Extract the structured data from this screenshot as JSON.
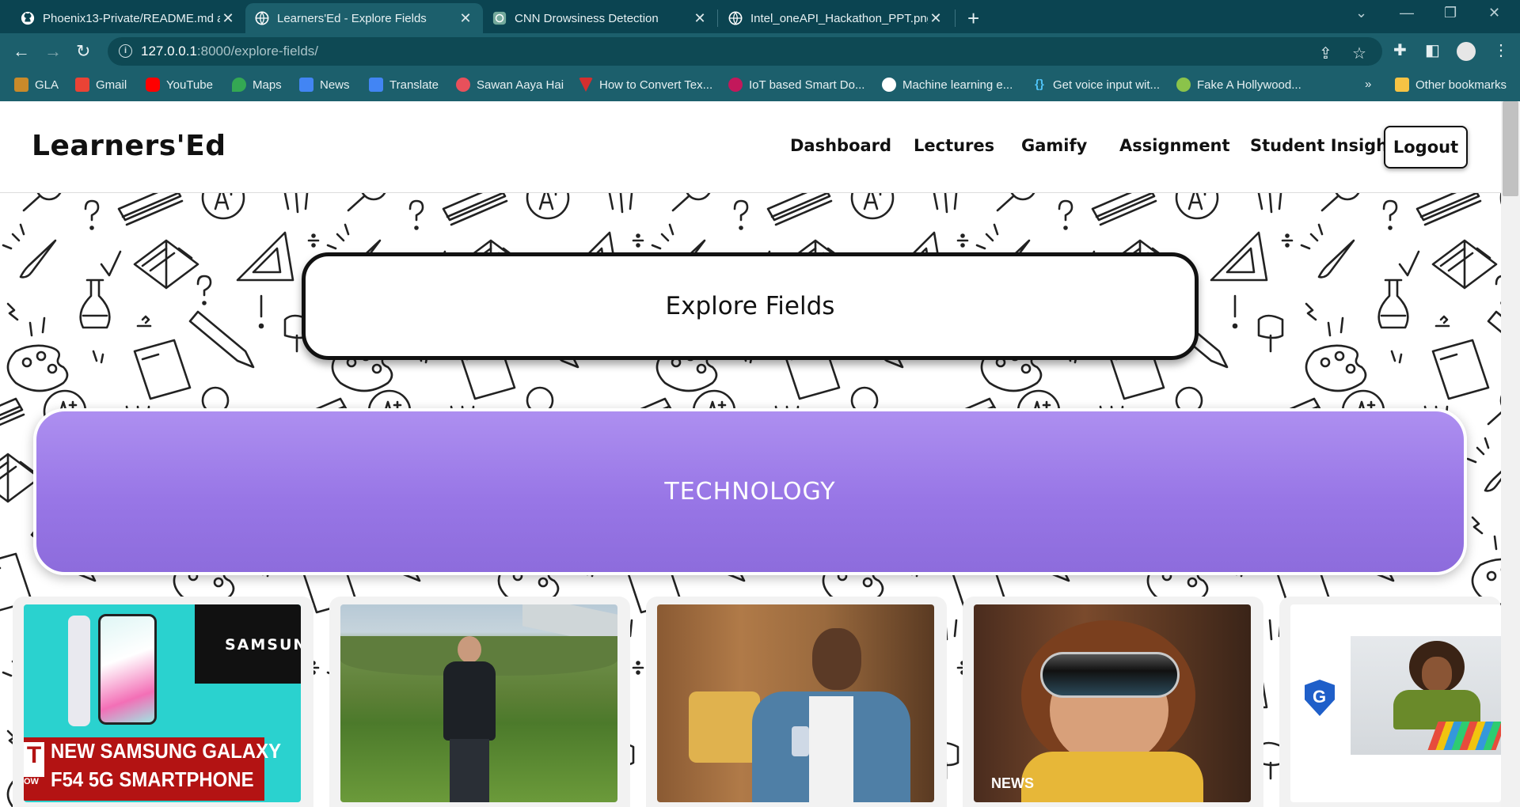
{
  "browser": {
    "tabs": [
      {
        "title": "Phoenix13-Private/README.md a",
        "active": false
      },
      {
        "title": "Learners'Ed - Explore Fields",
        "active": true
      },
      {
        "title": "CNN Drowsiness Detection",
        "active": false
      },
      {
        "title": "Intel_oneAPI_Hackathon_PPT.png",
        "active": false
      }
    ],
    "url_host": "127.0.0.1",
    "url_rest": ":8000/explore-fields/",
    "bookmarks": [
      {
        "label": "GLA",
        "color": "#c98a2a"
      },
      {
        "label": "Gmail",
        "color": "#ea4335"
      },
      {
        "label": "YouTube",
        "color": "#ff0000"
      },
      {
        "label": "Maps",
        "color": "#34a853"
      },
      {
        "label": "News",
        "color": "#4285f4"
      },
      {
        "label": "Translate",
        "color": "#4285f4"
      },
      {
        "label": "Sawan Aaya Hai",
        "color": "#e8505b"
      },
      {
        "label": "How to Convert Tex...",
        "color": "#d32f2f"
      },
      {
        "label": "IoT based Smart Do...",
        "color": "#c2185b"
      },
      {
        "label": "Machine learning e...",
        "color": "#ffffff"
      },
      {
        "label": "Get voice input wit...",
        "color": "#4fc3f7"
      },
      {
        "label": "Fake A Hollywood...",
        "color": "#8bc34a"
      }
    ],
    "bookmarks_overflow": "»",
    "other_bookmarks": "Other bookmarks"
  },
  "site": {
    "logo": "Learners'Ed",
    "nav": [
      "Dashboard",
      "Lectures",
      "Gamify",
      "Assignment",
      "Student Insight"
    ],
    "logout": "Logout"
  },
  "explore_title": "Explore Fields",
  "field_banner": "TECHNOLOGY",
  "cards": [
    {
      "image": "samsung-galaxy-f54-thumbnail",
      "overlay_brand": "SAMSUNG",
      "overlay_line1": "NEW SAMSUNG GALAXY",
      "overlay_line2": "F54 5G SMARTPHONE",
      "overlay_badge": "T",
      "overlay_small": "OW"
    },
    {
      "image": "man-presenting-outdoors-photo"
    },
    {
      "image": "man-looking-at-phone-photo"
    },
    {
      "image": "woman-wearing-vr-headset-photo",
      "overlay_source": "NEWS"
    },
    {
      "image": "woman-at-desk-with-shield-logo-photo"
    }
  ],
  "colors": {
    "chrome_dark": "#0b4451",
    "chrome_light": "#1c5f6c",
    "banner_purple": "#9876e6"
  }
}
